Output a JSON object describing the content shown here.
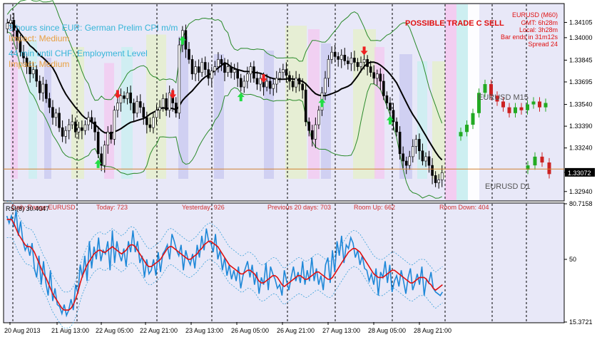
{
  "chart_data": {
    "type": "candlestick",
    "symbol_header": "EURUSD (M60)",
    "info_lines": [
      "GMT: 6h28m",
      "Local: 3h28m",
      "Bar ends in 31m12s",
      "Spread 24"
    ],
    "news": [
      {
        "line1": "3 hours since EUR: German Prelim CPI m/m",
        "line2": "Impact: Medium"
      },
      {
        "line1": "44 min until CHF: Employment Level",
        "line2": "Impact: Medium"
      }
    ],
    "signal_text": "POSSIBLE TRADE C SELL",
    "mini_labels": [
      "EURUSD M15",
      "EURUSD D1"
    ],
    "range_labels": [
      "Daily Range EURUSD",
      "Today: 723",
      "Yesterday: 926",
      "Previous 20 days: 703",
      "Room Up: 662",
      "Room Down: 404"
    ],
    "price_axis": [
      "1.34105",
      "1.34000",
      "1.33845",
      "1.33695",
      "1.33540",
      "1.33390",
      "1.33240",
      "1.33072",
      "1.32940"
    ],
    "price_range": [
      1.3288,
      1.3423
    ],
    "current_price": "1.33072",
    "current_price_value": 1.33072,
    "indicator": {
      "title": "RSI(8) 30.4047",
      "scale": [
        "80.7158",
        "50",
        "15.3721"
      ],
      "range": [
        15.3721,
        80.7158
      ],
      "ma_series": [
        72,
        72,
        72,
        70,
        67,
        64,
        62,
        60,
        58,
        57,
        57,
        56,
        54,
        51,
        48,
        45,
        42,
        40,
        37,
        34,
        31,
        29,
        27,
        25,
        23,
        22,
        22,
        22,
        23,
        25,
        28,
        32,
        37,
        41,
        44,
        47,
        49,
        51,
        53,
        54,
        55,
        55,
        54,
        54,
        55,
        56,
        57,
        56,
        55,
        54,
        53,
        54,
        55,
        57,
        58,
        58,
        57,
        55,
        53,
        51,
        49,
        47,
        46,
        46,
        47,
        48,
        49,
        50,
        52,
        54,
        56,
        57,
        57,
        56,
        55,
        54,
        53,
        52,
        51,
        50,
        50,
        51,
        52,
        53,
        55,
        56,
        58,
        59,
        60,
        60,
        59,
        58,
        57,
        55,
        53,
        51,
        49,
        47,
        46,
        45,
        44,
        43,
        42,
        42,
        43,
        44,
        44,
        43,
        42,
        40,
        38,
        37,
        37,
        38,
        39,
        40,
        41,
        41,
        40,
        38,
        36,
        35,
        36,
        37,
        38,
        39,
        40,
        41,
        41,
        40,
        39,
        39,
        40,
        41,
        42,
        43,
        43,
        42,
        41,
        40,
        39,
        39,
        40,
        42,
        44,
        46,
        48,
        50,
        52,
        54,
        55,
        56,
        56,
        55,
        54,
        52,
        50,
        48,
        46,
        44,
        42,
        41,
        40,
        40,
        40,
        41,
        42,
        43,
        44,
        44,
        43,
        42,
        41,
        40,
        39,
        38,
        37,
        37,
        38,
        39,
        40,
        40,
        40,
        39,
        37,
        36,
        34,
        33,
        34,
        35,
        36
      ],
      "rsi_series": [
        74,
        70,
        74,
        68,
        77,
        63,
        71,
        60,
        55,
        58,
        52,
        59,
        45,
        40,
        52,
        36,
        49,
        37,
        30,
        44,
        27,
        34,
        25,
        24,
        20,
        25,
        19,
        22,
        28,
        22,
        36,
        31,
        47,
        40,
        52,
        38,
        60,
        45,
        57,
        50,
        62,
        49,
        55,
        53,
        60,
        44,
        66,
        48,
        60,
        53,
        49,
        56,
        46,
        60,
        54,
        66,
        54,
        60,
        48,
        52,
        40,
        50,
        42,
        44,
        50,
        41,
        54,
        43,
        53,
        55,
        58,
        50,
        64,
        60,
        55,
        52,
        58,
        44,
        55,
        50,
        47,
        53,
        45,
        58,
        51,
        63,
        55,
        67,
        60,
        59,
        54,
        64,
        50,
        55,
        44,
        51,
        41,
        47,
        39,
        44,
        38,
        46,
        34,
        41,
        45,
        49,
        40,
        47,
        36,
        43,
        31,
        40,
        36,
        48,
        33,
        46,
        42,
        39,
        34,
        36,
        30,
        44,
        38,
        33,
        40,
        46,
        38,
        43,
        37,
        49,
        36,
        44,
        38,
        51,
        38,
        45,
        36,
        41,
        33,
        47,
        51,
        37,
        55,
        43,
        60,
        52,
        63,
        48,
        58,
        56,
        62,
        59,
        51,
        55,
        47,
        52,
        45,
        44,
        38,
        42,
        36,
        45,
        30,
        43,
        40,
        49,
        37,
        47,
        32,
        38,
        41,
        35,
        44,
        38,
        31,
        40,
        45,
        33,
        37,
        42,
        36,
        46,
        30,
        39,
        37,
        43,
        34,
        32,
        31,
        30,
        32
      ]
    },
    "time_axis": [
      "20 Aug 2013",
      "21 Aug 13:00",
      "22 Aug 05:00",
      "22 Aug 21:00",
      "23 Aug 13:00",
      "26 Aug 05:00",
      "26 Aug 21:00",
      "27 Aug 13:00",
      "28 Aug 05:00",
      "28 Aug 21:00"
    ],
    "main_close": [
      1.341,
      1.3412,
      1.3405,
      1.3398,
      1.339,
      1.3386,
      1.338,
      1.3375,
      1.3378,
      1.337,
      1.3362,
      1.3368,
      1.3358,
      1.3352,
      1.3345,
      1.3348,
      1.3338,
      1.3332,
      1.3336,
      1.334,
      1.3342,
      1.3335,
      1.3338,
      1.3336,
      1.334,
      1.3345,
      1.3342,
      1.3335,
      1.332,
      1.3312,
      1.3326,
      1.3335,
      1.333,
      1.335,
      1.3355,
      1.336,
      1.3358,
      1.3362,
      1.3355,
      1.3348,
      1.3356,
      1.3352,
      1.3345,
      1.334,
      1.3338,
      1.3345,
      1.335,
      1.3352,
      1.3358,
      1.335,
      1.3362,
      1.3355,
      1.3348,
      1.3395,
      1.3405,
      1.3392,
      1.3385,
      1.3375,
      1.338,
      1.3376,
      1.3383,
      1.3378,
      1.3372,
      1.3377,
      1.338,
      1.3385,
      1.3382,
      1.3376,
      1.338,
      1.3376,
      1.3378,
      1.3372,
      1.3366,
      1.337,
      1.3375,
      1.338,
      1.3372,
      1.3368,
      1.3372,
      1.3366,
      1.337,
      1.3365,
      1.3368,
      1.3372,
      1.3376,
      1.3378,
      1.3374,
      1.337,
      1.3366,
      1.3372,
      1.3368,
      1.3364,
      1.3342,
      1.3336,
      1.333,
      1.334,
      1.335,
      1.3362,
      1.3372,
      1.3385,
      1.339,
      1.3387,
      1.3385,
      1.3388,
      1.3384,
      1.3382,
      1.3386,
      1.3383,
      1.338,
      1.3383,
      1.3385,
      1.338,
      1.3376,
      1.3372,
      1.3375,
      1.337,
      1.336,
      1.3355,
      1.335,
      1.3342,
      1.3335,
      1.332,
      1.3315,
      1.3312,
      1.3318,
      1.3325,
      1.333,
      1.3322,
      1.3315,
      1.3318,
      1.3312,
      1.3305,
      1.33,
      1.3302,
      1.3307
    ],
    "m15_close": [
      1.3335,
      1.334,
      1.3348,
      1.3362,
      1.3368,
      1.336,
      1.3356,
      1.3352,
      1.3348,
      1.3352,
      1.335,
      1.3354,
      1.3356,
      1.3352,
      1.3355
    ],
    "d1_close": [
      1.3312,
      1.3318,
      1.3314,
      1.3306
    ],
    "sr_price": 1.33095
  }
}
